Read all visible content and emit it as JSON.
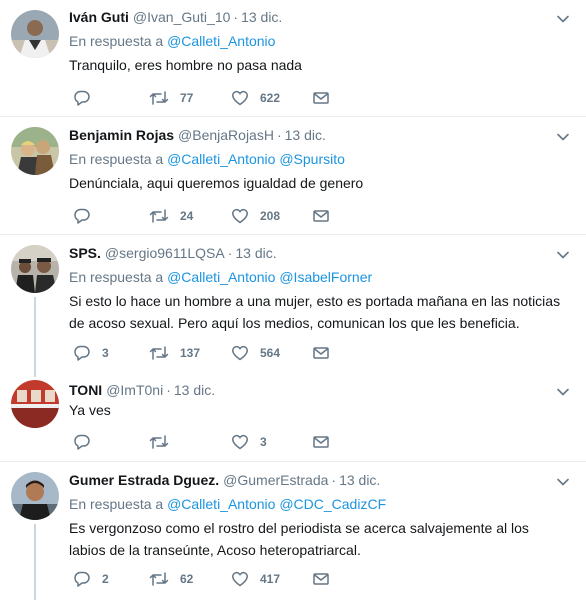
{
  "reply_prefix": "En respuesta a",
  "tweets": [
    {
      "name": "Iván Guti",
      "handle": "@Ivan_Guti_10",
      "sep": "·",
      "date": "13 dic.",
      "mentions": "@Calleti_Antonio",
      "text": "Tranquilo, eres hombre no pasa nada",
      "replies": "",
      "retweets": "77",
      "likes": "622"
    },
    {
      "name": "Benjamin Rojas",
      "handle": "@BenjaRojasH",
      "sep": "·",
      "date": "13 dic.",
      "mentions": "@Calleti_Antonio @Spursito",
      "text": "Denúnciala, aqui queremos igualdad de genero",
      "replies": "",
      "retweets": "24",
      "likes": "208"
    },
    {
      "name": "SPS.",
      "handle": "@sergio9611LQSA",
      "sep": "·",
      "date": "13 dic.",
      "mentions": "@Calleti_Antonio @IsabelForner",
      "text": "Si esto lo hace un hombre a una mujer, esto es portada mañana en las noticias de acoso sexual. Pero aquí los medios, comunican los que les beneficia.",
      "replies": "3",
      "retweets": "137",
      "likes": "564"
    },
    {
      "name": "TONI",
      "handle": "@ImT0ni",
      "sep": "·",
      "date": "13 dic.",
      "mentions": "",
      "text": "Ya ves",
      "replies": "",
      "retweets": "",
      "likes": "3"
    },
    {
      "name": "Gumer Estrada Dguez.",
      "handle": "@GumerEstrada",
      "sep": "·",
      "date": "13 dic.",
      "mentions": "@Calleti_Antonio @CDC_CadizCF",
      "text": "Es vergonzoso como el rostro del periodista se acerca salvajemente al los labios de la transeúnte, Acoso heteropatriarcal.",
      "replies": "2",
      "retweets": "62",
      "likes": "417"
    }
  ],
  "colors": {
    "text": "#14171a",
    "muted": "#657786",
    "link": "#1b95e0",
    "divider": "#e6ecf0",
    "thread_line": "#ccd6dd"
  },
  "icons": [
    "reply-icon",
    "retweet-icon",
    "like-icon",
    "dm-icon",
    "caret-down-icon"
  ]
}
